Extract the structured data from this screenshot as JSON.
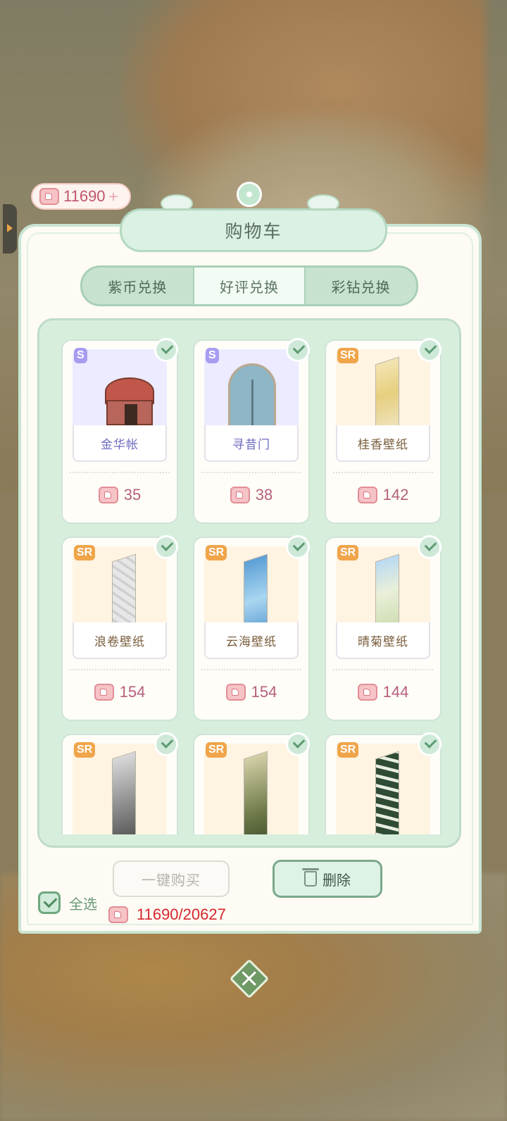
{
  "currency": {
    "value": "11690",
    "plus": "+"
  },
  "title": "购物车",
  "tabs": [
    {
      "label": "紫币兑换",
      "active": false
    },
    {
      "label": "好评兑换",
      "active": true
    },
    {
      "label": "彩钻兑换",
      "active": false
    }
  ],
  "items": [
    {
      "rarity": "S",
      "name": "金华帐",
      "price": "35",
      "checked": true,
      "art": "tent"
    },
    {
      "rarity": "S",
      "name": "寻昔门",
      "price": "38",
      "checked": true,
      "art": "door"
    },
    {
      "rarity": "SR",
      "name": "桂香壁纸",
      "price": "142",
      "checked": true,
      "art": "wallpaper-gold"
    },
    {
      "rarity": "SR",
      "name": "浪卷壁纸",
      "price": "154",
      "checked": true,
      "art": "wallpaper-grey"
    },
    {
      "rarity": "SR",
      "name": "云海壁纸",
      "price": "154",
      "checked": true,
      "art": "wallpaper-cloud"
    },
    {
      "rarity": "SR",
      "name": "晴菊壁纸",
      "price": "144",
      "checked": true,
      "art": "wallpaper-daisy"
    },
    {
      "rarity": "SR",
      "name": "",
      "price": "",
      "checked": true,
      "art": "wallpaper-mist"
    },
    {
      "rarity": "SR",
      "name": "",
      "price": "",
      "checked": true,
      "art": "wallpaper-bamboo"
    },
    {
      "rarity": "SR",
      "name": "",
      "price": "",
      "checked": true,
      "art": "wallpaper-pine"
    }
  ],
  "footer": {
    "select_all_label": "全选",
    "buy_label": "一键购买",
    "delete_label": "删除",
    "budget": "11690/20627"
  },
  "icons": {
    "currency": "thumbs-up-icon",
    "check": "check-icon",
    "delete": "trash-icon",
    "close": "close-icon"
  },
  "colors": {
    "accent_green": "#c7e3cf",
    "price_pink": "#b55f7a",
    "budget_red": "#d7262c",
    "rarity_S": "#a79cf0",
    "rarity_SR": "#f0a54a"
  }
}
